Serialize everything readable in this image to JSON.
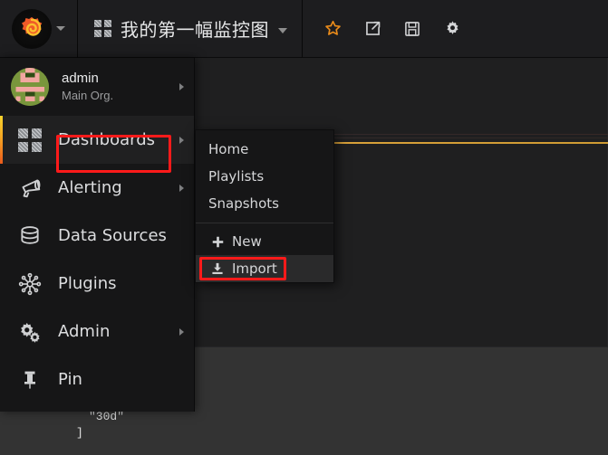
{
  "app": {
    "name": "Grafana",
    "theme_bg": "#333333",
    "accent": "#f5a623",
    "highlight_color": "#ff1a1a"
  },
  "topbar": {
    "logo_icon": "grafana-logo-icon",
    "logo_caret_icon": "chevron-down-icon",
    "dashboard_icon": "dashboard-grid-icon",
    "dashboard_title": "我的第一幅监控图",
    "title_caret_icon": "chevron-down-icon",
    "actions": [
      {
        "name": "mark-as-favorite-button",
        "icon": "star-icon",
        "label": "Mark as favorite"
      },
      {
        "name": "share-dashboard-button",
        "icon": "share-icon",
        "label": "Share dashboard"
      },
      {
        "name": "save-dashboard-button",
        "icon": "save-disk-icon",
        "label": "Save dashboard"
      },
      {
        "name": "dashboard-settings-button",
        "icon": "gear-icon",
        "label": "Dashboard settings"
      }
    ]
  },
  "sidebar": {
    "user": {
      "name": "admin",
      "org": "Main Org.",
      "avatar_icon": "user-avatar-identicon",
      "caret_icon": "chevron-right-icon"
    },
    "items": [
      {
        "label": "Dashboards",
        "icon": "dashboard-grid-icon",
        "active": true,
        "has_submenu": true
      },
      {
        "label": "Alerting",
        "icon": "megaphone-icon",
        "active": false,
        "has_submenu": true
      },
      {
        "label": "Data Sources",
        "icon": "database-icon",
        "active": false,
        "has_submenu": false
      },
      {
        "label": "Plugins",
        "icon": "plugin-icon",
        "active": false,
        "has_submenu": false
      },
      {
        "label": "Admin",
        "icon": "gears-icon",
        "active": false,
        "has_submenu": true
      },
      {
        "label": "Pin",
        "icon": "pin-icon",
        "active": false,
        "has_submenu": false
      }
    ]
  },
  "submenu": {
    "parent": "Dashboards",
    "items": [
      {
        "label": "Home",
        "icon": null,
        "highlighted": false
      },
      {
        "label": "Playlists",
        "icon": null,
        "highlighted": false
      },
      {
        "label": "Snapshots",
        "icon": null,
        "highlighted": false
      }
    ],
    "actions": [
      {
        "label": "New",
        "icon": "plus-icon",
        "highlighted": false
      },
      {
        "label": "Import",
        "icon": "import-download-icon",
        "highlighted": true
      }
    ]
  },
  "annotations": [
    {
      "name": "dashboards-highlight",
      "target": "Dashboards",
      "color": "#ff1a1a"
    },
    {
      "name": "import-highlight",
      "target": "Import",
      "color": "#ff1a1a"
    }
  ],
  "background": {
    "code_lines": [
      "\"30d\"",
      "]"
    ]
  }
}
